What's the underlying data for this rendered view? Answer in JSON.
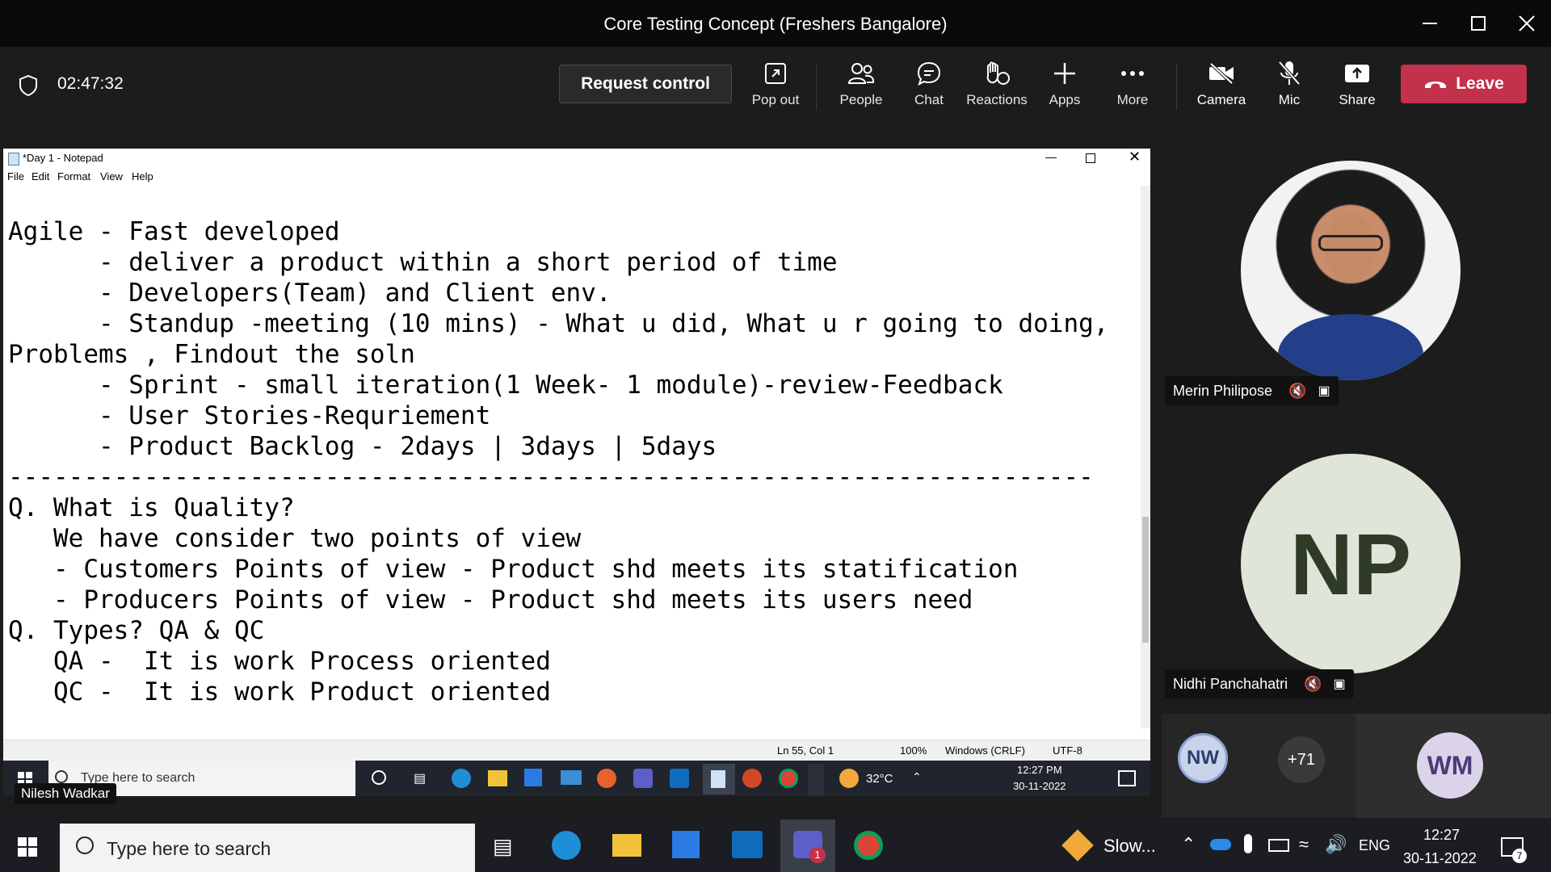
{
  "window": {
    "title": "Core Testing Concept (Freshers Bangalore)"
  },
  "toolbar": {
    "timer": "02:47:32",
    "request_control": "Request control",
    "pop_out": "Pop out",
    "people": "People",
    "chat": "Chat",
    "reactions": "Reactions",
    "apps": "Apps",
    "more": "More",
    "camera": "Camera",
    "mic": "Mic",
    "share": "Share",
    "leave": "Leave"
  },
  "notepad": {
    "title": "*Day 1 - Notepad",
    "menu": [
      "File",
      "Edit",
      "Format",
      "View",
      "Help"
    ],
    "lines": [
      "Agile - Fast developed",
      "      - deliver a product within a short period of time",
      "      - Developers(Team) and Client env.",
      "      - Standup -meeting (10 mins) - What u did, What u r going to doing,",
      "Problems , Findout the soln",
      "      - Sprint - small iteration(1 Week- 1 module)-review-Feedback",
      "      - User Stories-Requriement",
      "      - Product Backlog - 2days | 3days | 5days",
      "------------------------------------------------------------------------",
      "Q. What is Quality?",
      "   We have consider two points of view",
      "   - Customers Points of view - Product shd meets its statification",
      "   - Producers Points of view - Product shd meets its users need",
      "Q. Types? QA & QC",
      "   QA -  It is work Process oriented",
      "   QC -  It is work Product oriented"
    ],
    "status": {
      "position": "Ln 55, Col 1",
      "zoom": "100%",
      "eol": "Windows (CRLF)",
      "encoding": "UTF-8"
    }
  },
  "shared_taskbar": {
    "search_placeholder": "Type here to search",
    "weather": "32°C",
    "time": "12:27 PM",
    "date": "30-11-2022",
    "presenter": "Nilesh Wadkar"
  },
  "participants": {
    "p1": {
      "name": "Merin Philipose"
    },
    "p2": {
      "name": "Nidhi Panchahatri",
      "initials": "NP"
    },
    "p3": {
      "initials": "NW"
    },
    "more_count": "+71",
    "p4": {
      "initials": "WM"
    }
  },
  "taskbar": {
    "search_placeholder": "Type here to search",
    "slow_label": "Slow...",
    "lang": "ENG",
    "time": "12:27",
    "date": "30-11-2022",
    "notif_count": "7"
  },
  "colors": {
    "leave": "#c4314b",
    "np_avatar_bg": "#dfe5d8",
    "np_avatar_text": "#2f3b27"
  }
}
